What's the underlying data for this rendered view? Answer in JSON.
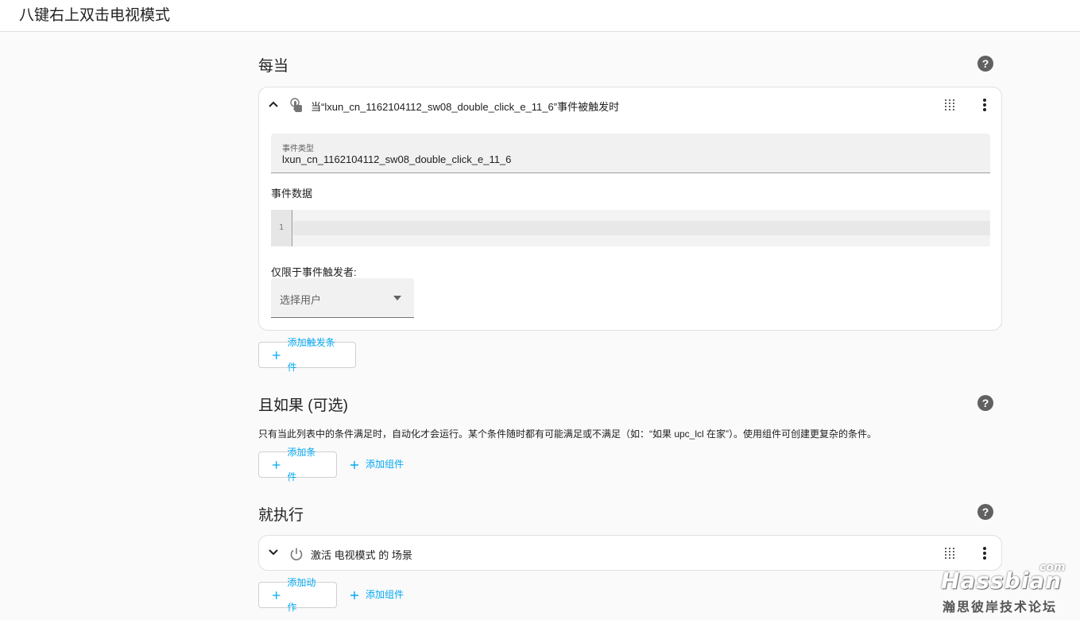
{
  "page_title": "八键右上双击电视模式",
  "trigger_section": {
    "title": "每当",
    "help": "?",
    "card": {
      "header": "当“lxun_cn_1162104112_sw08_double_click_e_11_6”事件被触发时",
      "event_type_label": "事件类型",
      "event_type_value": "lxun_cn_1162104112_sw08_double_click_e_11_6",
      "event_data_label": "事件数据",
      "line_number": "1",
      "limit_label": "仅限于事件触发者:",
      "select_user_placeholder": "选择用户"
    },
    "add_trigger": "添加触发条件"
  },
  "condition_section": {
    "title": "且如果 (可选)",
    "help": "?",
    "description": "只有当此列表中的条件满足时，自动化才会运行。某个条件随时都有可能满足或不满足（如：“如果 upc_lcl 在家”）。使用组件可创建更复杂的条件。",
    "add_condition": "添加条件",
    "add_building_block": "添加组件"
  },
  "action_section": {
    "title": "就执行",
    "help": "?",
    "card": {
      "header": "激活 电视模式 的 场景"
    },
    "add_action": "添加动作",
    "add_building_block": "添加组件"
  },
  "watermark": {
    "brand": "Hassbian",
    "com": "com",
    "cn": "瀚思彼岸技术论坛"
  }
}
